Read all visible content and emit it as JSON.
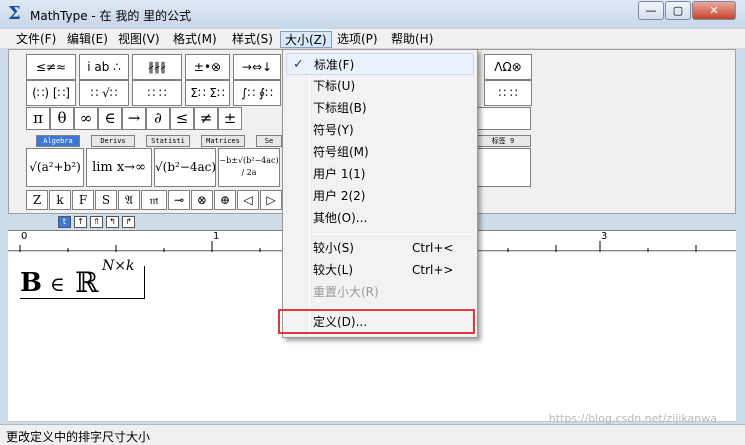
{
  "window": {
    "title": "MathType - 在 我的 里的公式",
    "controls": {
      "minimize": "—",
      "maximize": "▢",
      "close": "✕"
    }
  },
  "menubar": [
    "文件(F)",
    "编辑(E)",
    "视图(V)",
    "格式(M)",
    "样式(S)",
    "大小(Z)",
    "选项(P)",
    "帮助(H)"
  ],
  "size_menu": {
    "items": [
      {
        "label": "标准(F)",
        "checked": true
      },
      {
        "label": "下标(U)"
      },
      {
        "label": "下标组(B)"
      },
      {
        "label": "符号(Y)"
      },
      {
        "label": "符号组(M)"
      },
      {
        "label": "用户 1(1)"
      },
      {
        "label": "用户 2(2)"
      },
      {
        "label": "其他(O)..."
      },
      {
        "label": "较小(S)",
        "shortcut": "Ctrl+<"
      },
      {
        "label": "较大(L)",
        "shortcut": "Ctrl+>"
      },
      {
        "label": "重置小大(R)",
        "disabled": true
      },
      {
        "label": "定义(D)...",
        "highlighted": true
      }
    ]
  },
  "palettes": {
    "row1": [
      "≤≠≈",
      "i ab ∴",
      "∦∦∦",
      "±•⊗",
      "→⇔↓",
      "∴∀∃",
      "∉∩⊂",
      "∂∞ℓ",
      "λωθ",
      "ΛΩ⊗"
    ],
    "row2": [
      "(∷) [∷]",
      "∷ √∷",
      "∷ ∷",
      "Σ∷ Σ∷",
      "∫∷ ∮∷",
      "⎯ ⎯",
      "→ ←",
      "Ū Ů",
      "∷∷ ∷",
      "∷ ∷"
    ],
    "symbols": [
      "π",
      "θ",
      "∞",
      "∈",
      "→",
      "∂",
      "≤",
      "≠",
      "±"
    ],
    "tabs": [
      "Algebra",
      "Derivs",
      "Statisti",
      "Matrices",
      "Se",
      "标签 9"
    ],
    "templates": [
      "√(a²+b²)",
      "lim x→∞",
      "√(b²−4ac)",
      "−b±√(b²−4ac) / 2a"
    ],
    "small": [
      "Z",
      "k",
      "F",
      "S",
      "𝔄",
      "𝔪",
      "⊸",
      "⊗",
      "⊕",
      "◁",
      "▷"
    ],
    "nudge": [
      "t",
      "↑",
      "⇑",
      "↰",
      "↱"
    ]
  },
  "ruler": {
    "marks": [
      "0",
      "1",
      "3"
    ]
  },
  "equation": {
    "bold": "B",
    "op": "∈",
    "set": "ℝ",
    "sup": "N×k"
  },
  "status": {
    "text": "更改定义中的排字尺寸大小"
  },
  "watermark": "https://blog.csdn.net/zijikanwa"
}
